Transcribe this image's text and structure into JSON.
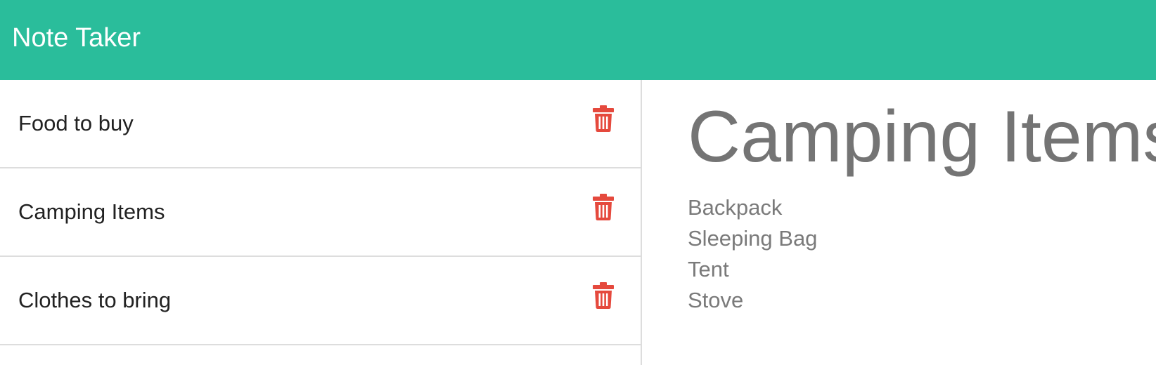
{
  "app": {
    "title": "Note Taker"
  },
  "colors": {
    "navbar": "#2abd9b",
    "delete_icon": "#e5493d",
    "divider": "#dddddd",
    "detail_text": "#747474"
  },
  "notes": [
    {
      "title": "Food to buy",
      "icon": "trash-icon"
    },
    {
      "title": "Camping Items",
      "icon": "trash-icon"
    },
    {
      "title": "Clothes to bring",
      "icon": "trash-icon"
    }
  ],
  "active_note": {
    "title": "Camping Items",
    "lines": [
      "Backpack",
      "Sleeping Bag",
      "Tent",
      "Stove"
    ]
  }
}
